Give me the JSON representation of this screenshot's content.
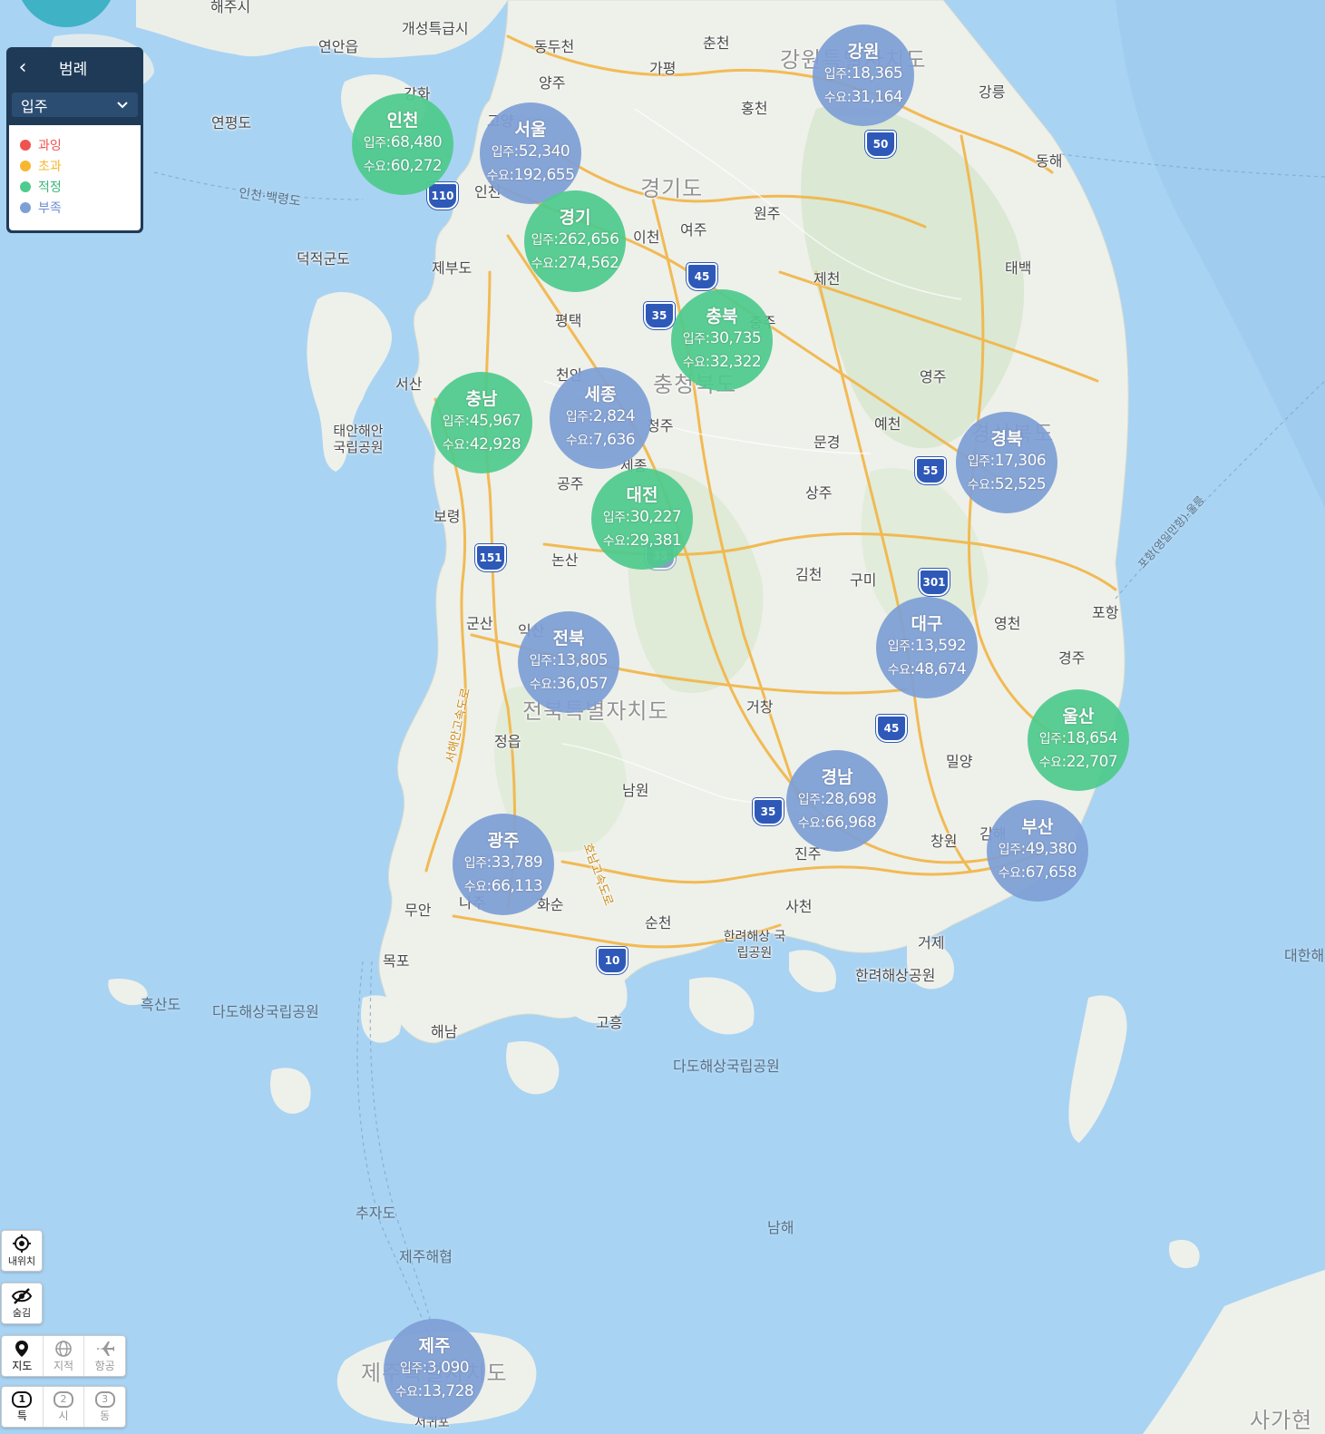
{
  "legend": {
    "title": "범례",
    "select_value": "입주",
    "items": [
      {
        "label": "과잉",
        "color": "#ef5350"
      },
      {
        "label": "초과",
        "color": "#f7b731"
      },
      {
        "label": "적정",
        "color": "#4ecb8d"
      },
      {
        "label": "부족",
        "color": "#7e9fd6"
      }
    ]
  },
  "colors": {
    "green": "#4ecb8d",
    "blue": "#7e9fd6",
    "sea": "#a9d3f2",
    "land": "#eef0ea",
    "road": "#f2b544"
  },
  "labels": {
    "supply": "입주",
    "demand": "수요"
  },
  "regions": [
    {
      "name": "인천",
      "supply": "68,480",
      "demand": "60,272",
      "status": "적정"
    },
    {
      "name": "서울",
      "supply": "52,340",
      "demand": "192,655",
      "status": "부족"
    },
    {
      "name": "경기",
      "supply": "262,656",
      "demand": "274,562",
      "status": "적정"
    },
    {
      "name": "강원",
      "supply": "18,365",
      "demand": "31,164",
      "status": "부족"
    },
    {
      "name": "충북",
      "supply": "30,735",
      "demand": "32,322",
      "status": "적정"
    },
    {
      "name": "충남",
      "supply": "45,967",
      "demand": "42,928",
      "status": "적정"
    },
    {
      "name": "세종",
      "supply": "2,824",
      "demand": "7,636",
      "status": "부족"
    },
    {
      "name": "대전",
      "supply": "30,227",
      "demand": "29,381",
      "status": "적정"
    },
    {
      "name": "경북",
      "supply": "17,306",
      "demand": "52,525",
      "status": "부족"
    },
    {
      "name": "전북",
      "supply": "13,805",
      "demand": "36,057",
      "status": "부족"
    },
    {
      "name": "대구",
      "supply": "13,592",
      "demand": "48,674",
      "status": "부족"
    },
    {
      "name": "울산",
      "supply": "18,654",
      "demand": "22,707",
      "status": "적정"
    },
    {
      "name": "경남",
      "supply": "28,698",
      "demand": "66,968",
      "status": "부족"
    },
    {
      "name": "부산",
      "supply": "49,380",
      "demand": "67,658",
      "status": "부족"
    },
    {
      "name": "광주",
      "supply": "33,789",
      "demand": "66,113",
      "status": "부족"
    },
    {
      "name": "제주",
      "supply": "3,090",
      "demand": "13,728",
      "status": "부족"
    }
  ],
  "places": [
    "해주시",
    "개성특급시",
    "연안읍",
    "동두천",
    "춘천",
    "양주",
    "가평",
    "강화",
    "연평도",
    "고양",
    "홍천",
    "강릉",
    "동해",
    "인천·백령도",
    "인천",
    "경기도",
    "원주",
    "이천",
    "여주",
    "덕적군도",
    "제부도",
    "제천",
    "태백",
    "평택",
    "충주",
    "서산",
    "천안",
    "영주",
    "충청북도",
    "태안해안 국립공원",
    "청주",
    "예천",
    "문경",
    "경상북도",
    "세종",
    "공주",
    "상주",
    "보령",
    "논산",
    "김천",
    "구미",
    "포항",
    "군산",
    "익산",
    "영천",
    "경주",
    "전북특별자치도",
    "거창",
    "정읍",
    "밀양",
    "남원",
    "진주",
    "김해",
    "창원",
    "사천",
    "화순",
    "나주",
    "무안",
    "순천",
    "목포",
    "한려해상 국립공원",
    "거제",
    "한려해상공원",
    "흑산도",
    "다도해상국립공원",
    "해남",
    "고흥",
    "다도해상국립공원",
    "추자도",
    "제주해협",
    "남해",
    "대한해",
    "사가현",
    "서귀포",
    "제주특별자치도",
    "강원특별자치도",
    "서해안고속도로",
    "호남고속도로",
    "포항(영일만항)-울릉"
  ],
  "shields": [
    "110",
    "50",
    "45",
    "35",
    "55",
    "151",
    "35",
    "301",
    "45",
    "35",
    "10"
  ],
  "controls": {
    "mylocation": "내위치",
    "hide": "숨김",
    "maptype": [
      "지도",
      "지적",
      "항공"
    ],
    "level": [
      "특",
      "시",
      "동"
    ],
    "level_nums": [
      "1",
      "2",
      "3"
    ]
  }
}
